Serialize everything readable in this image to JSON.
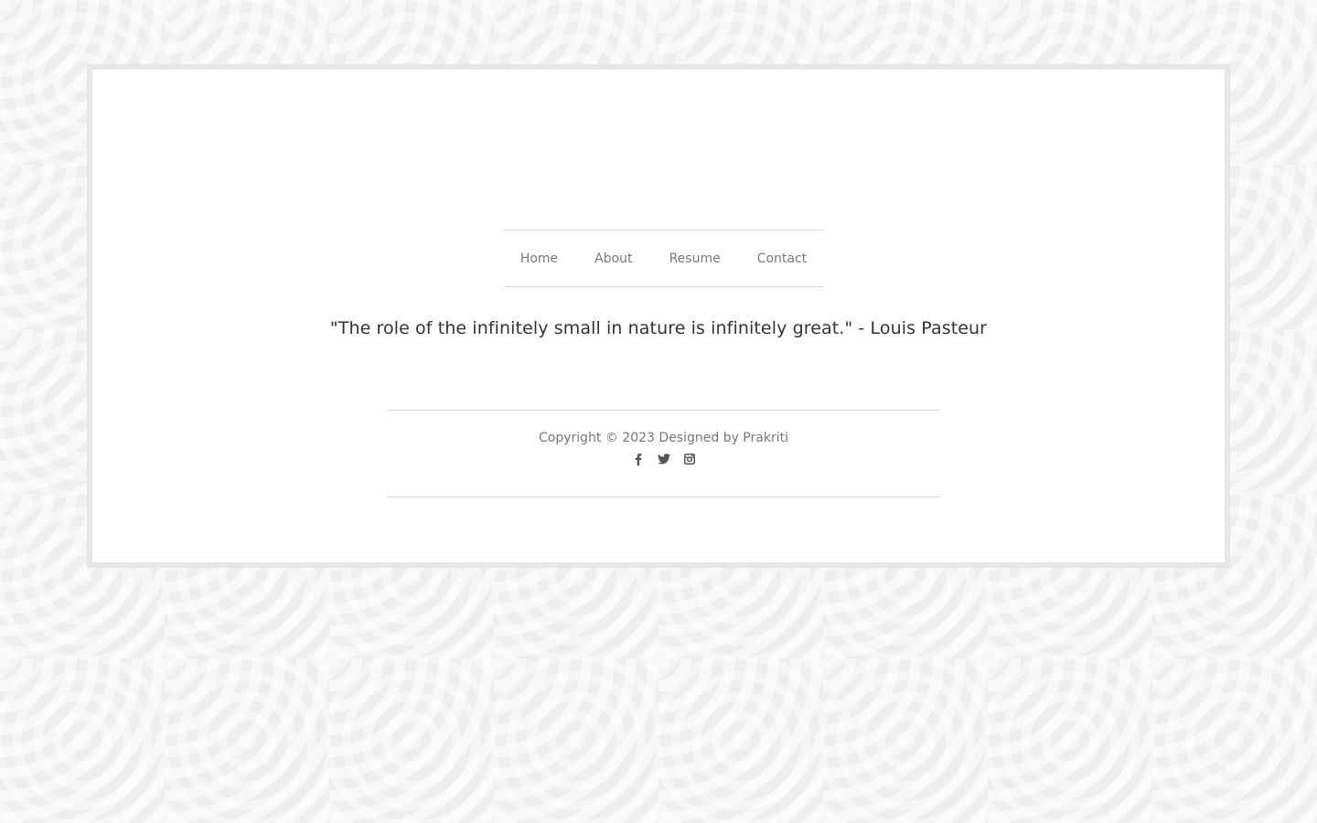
{
  "nav": {
    "items": [
      {
        "label": "Home"
      },
      {
        "label": "About"
      },
      {
        "label": "Resume"
      },
      {
        "label": "Contact"
      }
    ]
  },
  "quote": {
    "text": "\"The role of the infinitely small in nature is infinitely great.\" - Louis Pasteur"
  },
  "footer": {
    "copyright": "Copyright © 2023 Designed by Prakriti",
    "social": [
      {
        "icon": "facebook-icon"
      },
      {
        "icon": "twitter-icon"
      },
      {
        "icon": "instagram-icon"
      }
    ]
  },
  "colors": {
    "background": "#eeeeee",
    "frame_border": "#e6e6e6",
    "nav_text": "#7a7a7a",
    "quote_text": "#333333",
    "icon": "#555555"
  }
}
